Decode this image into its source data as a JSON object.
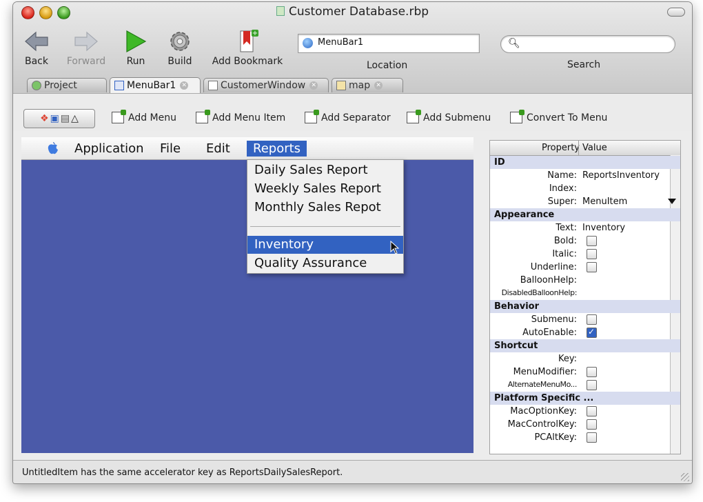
{
  "window": {
    "title": "Customer Database.rbp"
  },
  "toolbar": {
    "back": "Back",
    "forward": "Forward",
    "run": "Run",
    "build": "Build",
    "add_bookmark": "Add Bookmark",
    "location_value": "MenuBar1",
    "location_label": "Location",
    "search_label": "Search",
    "search_placeholder": ""
  },
  "tabs": [
    {
      "label": "Project"
    },
    {
      "label": "MenuBar1"
    },
    {
      "label": "CustomerWindow"
    },
    {
      "label": "map"
    }
  ],
  "editor_toolbar": {
    "add_menu": "Add Menu",
    "add_menu_item": "Add Menu Item",
    "add_separator": "Add Separator",
    "add_submenu": "Add Submenu",
    "convert_to_menu": "Convert To Menu"
  },
  "menubar": {
    "items": [
      "Application",
      "File",
      "Edit",
      "Reports"
    ],
    "selected": "Reports"
  },
  "dropdown": {
    "items": [
      "Daily Sales Report",
      "Weekly Sales Report",
      "Monthly Sales Repot",
      "Inventory",
      "Quality Assurance"
    ],
    "highlighted": "Inventory"
  },
  "properties": {
    "col_property": "Property",
    "col_value": "Value",
    "sections": {
      "id": "ID",
      "appearance": "Appearance",
      "behavior": "Behavior",
      "shortcut": "Shortcut",
      "platform": "Platform Specific ..."
    },
    "rows": {
      "name": {
        "label": "Name:",
        "value": "ReportsInventory"
      },
      "index": {
        "label": "Index:"
      },
      "super": {
        "label": "Super:",
        "value": "MenuItem"
      },
      "text": {
        "label": "Text:",
        "value": "Inventory"
      },
      "bold": {
        "label": "Bold:",
        "checked": false
      },
      "italic": {
        "label": "Italic:",
        "checked": false
      },
      "underline": {
        "label": "Underline:",
        "checked": false
      },
      "balloonhelp": {
        "label": "BalloonHelp:"
      },
      "disabledballoonhelp": {
        "label": "DisabledBalloonHelp:"
      },
      "submenu": {
        "label": "Submenu:",
        "checked": false
      },
      "autoenable": {
        "label": "AutoEnable:",
        "checked": true
      },
      "key": {
        "label": "Key:"
      },
      "menumodifier": {
        "label": "MenuModifier:",
        "checked": false
      },
      "alternatemenumod": {
        "label": "AlternateMenuMo...",
        "checked": false
      },
      "macoptionkey": {
        "label": "MacOptionKey:",
        "checked": false
      },
      "maccontrolkey": {
        "label": "MacControlKey:",
        "checked": false
      },
      "pcaltkey": {
        "label": "PCAltKey:",
        "checked": false
      }
    }
  },
  "status": {
    "text": "UntitledItem has the same accelerator key as ReportsDailySalesReport."
  }
}
